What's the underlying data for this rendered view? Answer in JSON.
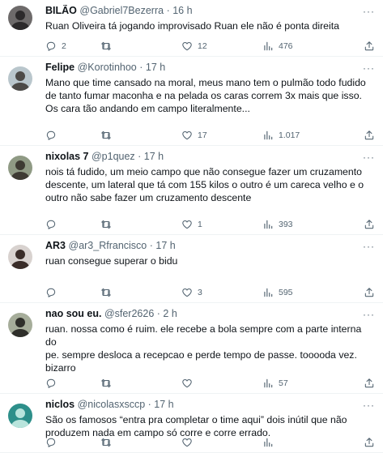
{
  "tweets": [
    {
      "name": "BILÃO",
      "handle": "@Gabriel7Bezerra",
      "time": "16 h",
      "lines": [
        "Ruan Oliveira tá jogando improvisado Ruan ele não é ponta direita"
      ],
      "replies": "2",
      "retweets": "",
      "likes": "12",
      "views": "476",
      "avatar": {
        "bg": "#6d6a6a",
        "fg": "#2c2a2b"
      }
    },
    {
      "name": "Felipe",
      "handle": "@Korotinhoo",
      "time": "17 h",
      "lines": [
        "Mano que time cansado na moral, meus mano tem o pulmão todo fudido",
        "de tanto fumar maconha e na pelada os caras correm 3x mais que isso.",
        "Os cara tão andando em campo literalmente..."
      ],
      "replies": "",
      "retweets": "",
      "likes": "17",
      "views": "1.017",
      "avatar": {
        "bg": "#b9c6cc",
        "fg": "#4c4a47"
      }
    },
    {
      "name": "nixolas 7",
      "handle": "@p1quez",
      "time": "17 h",
      "lines": [
        "nois tá fudido, um meio campo que não consegue fazer um cruzamento",
        "descente, um lateral que tá com 155 kilos  o outro é um careca velho e o",
        "outro não sabe fazer um cruzamento descente"
      ],
      "replies": "",
      "retweets": "",
      "likes": "1",
      "views": "393",
      "avatar": {
        "bg": "#8f9a84",
        "fg": "#3e3b33"
      }
    },
    {
      "name": "AR3",
      "handle": "@ar3_Rfrancisco",
      "time": "17 h",
      "lines": [
        "ruan consegue superar o bidu"
      ],
      "replies": "",
      "retweets": "",
      "likes": "3",
      "views": "595",
      "avatar": {
        "bg": "#d8d2cf",
        "fg": "#3a2d29"
      }
    },
    {
      "name": "nao sou eu.",
      "handle": "@sfer2626",
      "time": "2 h",
      "lines": [
        "ruan. nossa como é ruim. ele recebe a bola sempre com a parte interna do",
        "pe. sempre desloca a recepcao e perde tempo de passe. tooooda vez.",
        "bizarro"
      ],
      "replies": "",
      "retweets": "",
      "likes": "",
      "views": "57",
      "avatar": {
        "bg": "#a6ad9a",
        "fg": "#2f2f2a"
      }
    },
    {
      "name": "niclos",
      "handle": "@nicolasxsccp",
      "time": "17 h",
      "lines": [
        "São os famosos “entra pra completar o time aqui” dois inútil que não",
        "produzem nada em campo só corre e corre errado."
      ],
      "replies": "",
      "retweets": "",
      "likes": "",
      "views": "",
      "avatar": {
        "bg": "#2d8f8a",
        "fg": "#b8e4dc"
      }
    }
  ]
}
